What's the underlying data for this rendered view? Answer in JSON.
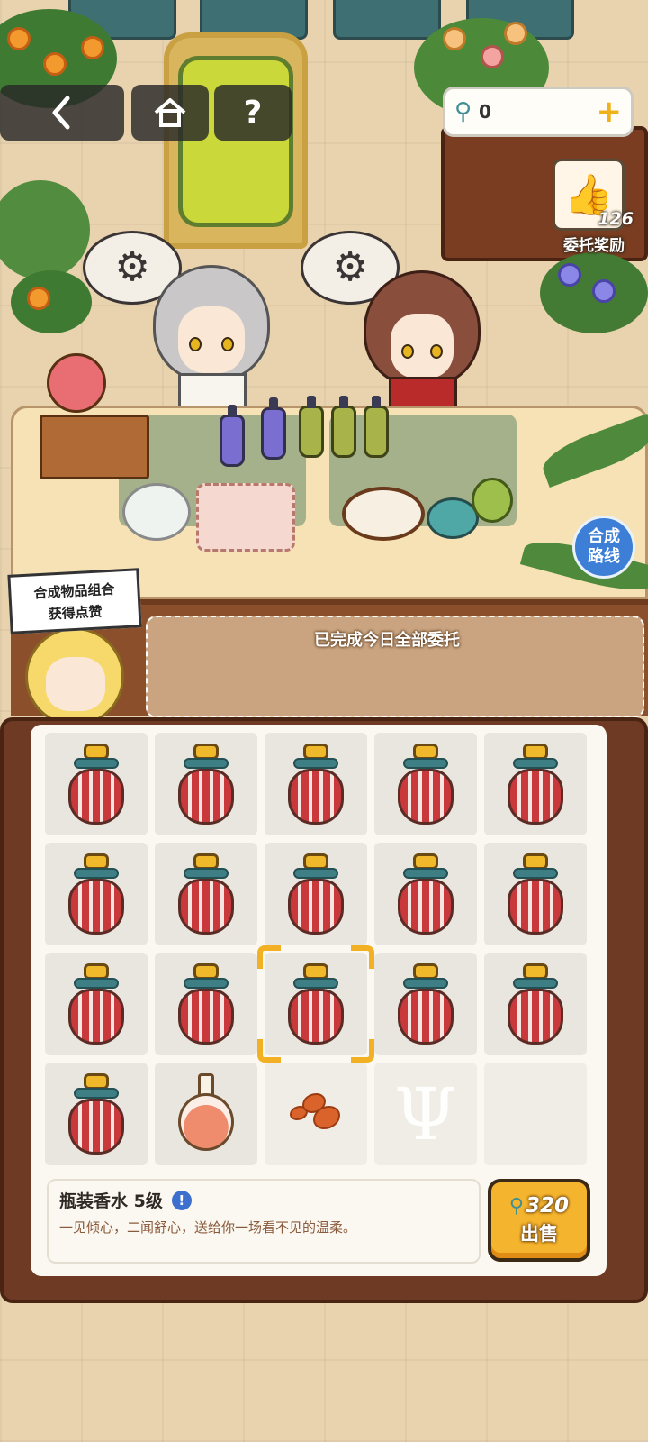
{
  "hud": {
    "back_icon": "chevron-left",
    "home_icon": "house",
    "help_label": "?",
    "currency_icon": "pipette",
    "currency_amount": "0",
    "add_label": "+"
  },
  "commission_reward": {
    "count": "126",
    "label": "委托奖励",
    "icon": "thumbs-up"
  },
  "synthesis_route": {
    "line1": "合成",
    "line2": "路线"
  },
  "tip_sign": {
    "line1": "合成物品组合",
    "line2": "获得点赞"
  },
  "status_text": "已完成今日全部委托",
  "inventory": {
    "rows": 4,
    "columns": 5,
    "selected_slot": 12,
    "slots": [
      "bottled-perfume",
      "bottled-perfume",
      "bottled-perfume",
      "bottled-perfume",
      "bottled-perfume",
      "bottled-perfume",
      "bottled-perfume",
      "bottled-perfume",
      "bottled-perfume",
      "bottled-perfume",
      "bottled-perfume",
      "bottled-perfume",
      "bottled-perfume",
      "bottled-perfume",
      "bottled-perfume",
      "bottled-perfume",
      "flower-essence-flask",
      "petals",
      "empty-locked",
      "empty"
    ]
  },
  "selected_item": {
    "name": "瓶装香水 5级",
    "description": "一见倾心，二闻舒心，送给你一场看不见的温柔。",
    "info_icon": "exclamation"
  },
  "sell": {
    "price": "320",
    "label": "出售",
    "currency_icon": "pipette"
  }
}
